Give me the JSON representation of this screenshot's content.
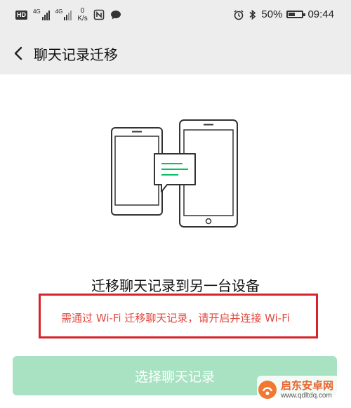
{
  "status_bar": {
    "hd": "HD",
    "network1": "4G",
    "network2": "4G",
    "speed_value": "0",
    "speed_unit": "K/s",
    "battery_percent": "50%",
    "battery_level": 0.5,
    "time": "09:44"
  },
  "header": {
    "title": "聊天记录迁移"
  },
  "main": {
    "headline": "迁移聊天记录到另一台设备",
    "warning": "需通过 Wi-Fi 迁移聊天记录，请开启并连接 Wi-Fi",
    "button_label": "选择聊天记录"
  },
  "watermark": {
    "title": "启东安卓网",
    "url": "www.qdltdq.com"
  },
  "colors": {
    "accent_green": "#07c160",
    "button_disabled": "#a9e2c2",
    "warning_red": "#e0493f",
    "annotation_box": "#d8232a"
  }
}
